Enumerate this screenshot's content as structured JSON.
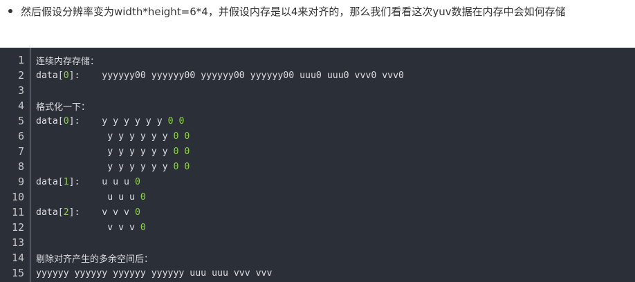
{
  "bullet": {
    "text": "然后假设分辨率变为width*height=6*4，并假设内存是以4来对齐的，那么我们看看这次yuv数据在内存中会如何存储"
  },
  "code": {
    "lines": [
      {
        "n": "1",
        "segs": [
          {
            "t": "连续内存存储：",
            "k": "cjk"
          }
        ]
      },
      {
        "n": "2",
        "segs": [
          {
            "t": "data["
          },
          {
            "t": "0",
            "k": "num"
          },
          {
            "t": "]:    yyyyyy00 yyyyyy00 yyyyyy00 yyyyyy00 uuu0 uuu0 vvv0 vvv0"
          }
        ]
      },
      {
        "n": "3",
        "segs": []
      },
      {
        "n": "4",
        "segs": [
          {
            "t": "格式化一下：",
            "k": "cjk"
          }
        ]
      },
      {
        "n": "5",
        "segs": [
          {
            "t": "data["
          },
          {
            "t": "0",
            "k": "num"
          },
          {
            "t": "]:    y y y y y y "
          },
          {
            "t": "0 0",
            "k": "num"
          }
        ]
      },
      {
        "n": "6",
        "segs": [
          {
            "t": "             y y y y y y "
          },
          {
            "t": "0 0",
            "k": "num"
          }
        ]
      },
      {
        "n": "7",
        "segs": [
          {
            "t": "             y y y y y y "
          },
          {
            "t": "0 0",
            "k": "num"
          }
        ]
      },
      {
        "n": "8",
        "segs": [
          {
            "t": "             y y y y y y "
          },
          {
            "t": "0 0",
            "k": "num"
          }
        ]
      },
      {
        "n": "9",
        "segs": [
          {
            "t": "data["
          },
          {
            "t": "1",
            "k": "num"
          },
          {
            "t": "]:    u u u "
          },
          {
            "t": "0",
            "k": "num"
          }
        ]
      },
      {
        "n": "10",
        "segs": [
          {
            "t": "             u u u "
          },
          {
            "t": "0",
            "k": "num"
          }
        ]
      },
      {
        "n": "11",
        "segs": [
          {
            "t": "data["
          },
          {
            "t": "2",
            "k": "num"
          },
          {
            "t": "]:    v v v "
          },
          {
            "t": "0",
            "k": "num"
          }
        ]
      },
      {
        "n": "12",
        "segs": [
          {
            "t": "             v v v "
          },
          {
            "t": "0",
            "k": "num"
          }
        ]
      },
      {
        "n": "13",
        "segs": []
      },
      {
        "n": "14",
        "segs": [
          {
            "t": "剔除对齐产生的多余空间后：",
            "k": "cjk"
          }
        ]
      },
      {
        "n": "15",
        "segs": [
          {
            "t": "yyyyyy yyyyyy yyyyyy yyyyyy uuu uuu vvv vvv"
          }
        ]
      }
    ]
  }
}
